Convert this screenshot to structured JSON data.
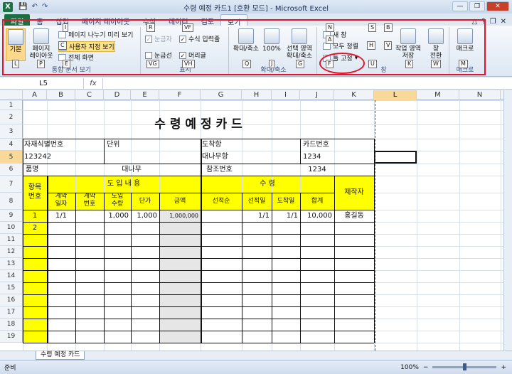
{
  "window": {
    "title": "수령 예정 카드1 [호환 모드] - Microsoft Excel",
    "app_letter": "X",
    "minimize": "—",
    "restore": "❐",
    "close": "✕"
  },
  "qat": {
    "save": "💾",
    "undo": "↶",
    "redo": "↷"
  },
  "tabs": [
    {
      "label": "파일",
      "kt": "F"
    },
    {
      "label": "홈",
      "kt": "H"
    },
    {
      "label": "삽입",
      "kt": "N"
    },
    {
      "label": "페이지 레이아웃",
      "kt": "P"
    },
    {
      "label": "수식",
      "kt": "M"
    },
    {
      "label": "데이터",
      "kt": "A"
    },
    {
      "label": "검토",
      "kt": "R"
    },
    {
      "label": "보기",
      "kt": "W"
    }
  ],
  "tab_right": {
    "minimize_ribbon": "△",
    "help": "?",
    "restore": "❐",
    "close": "✕"
  },
  "ribbon": {
    "workbook_views": {
      "label": "통합 문서 보기",
      "normal": "기본",
      "page_layout": "페이지\n레이아웃",
      "page_break": "페이지 나누기 미리 보기",
      "custom_views": "사용자 지정 보기",
      "full_screen": "전체 화면"
    },
    "show": {
      "label": "표시",
      "ruler": "눈금자",
      "formula_bar": "수식 입력줄",
      "gridlines": "눈금선",
      "headings": "머리글"
    },
    "zoom": {
      "label": "확대/축소",
      "zoom": "확대/축소",
      "hundred": "100%",
      "selection": "선택 영역\n확대/축소"
    },
    "window": {
      "label": "창",
      "new_window": "새 창",
      "arrange_all": "모두 정렬",
      "freeze": "틀 고정",
      "workspace": "작업 영역\n저장",
      "switch": "창\n전환"
    },
    "macros": {
      "label": "매크로",
      "macros": "매크로"
    }
  },
  "keytips": [
    "L",
    "P",
    "I",
    "C",
    "E",
    "R",
    "VF",
    "VG",
    "VH",
    "Q",
    "J",
    "G",
    "N",
    "A",
    "F",
    "S",
    "H",
    "U",
    "B",
    "V",
    "K",
    "W",
    "M"
  ],
  "formula_bar": {
    "name_box": "L5",
    "fx": "fx",
    "value": ""
  },
  "columns": [
    "A",
    "B",
    "C",
    "D",
    "E",
    "F",
    "G",
    "H",
    "I",
    "J",
    "K",
    "L",
    "M",
    "N"
  ],
  "rows": [
    "1",
    "2",
    "3",
    "4",
    "5",
    "6",
    "7",
    "8",
    "9",
    "10",
    "11",
    "12",
    "13",
    "14",
    "15",
    "16",
    "17",
    "18",
    "19"
  ],
  "selected": {
    "column": "L",
    "row": "5"
  },
  "sheet": {
    "title": "수 령 예 정 카 드",
    "asset_no_label": "자재식별번호",
    "asset_no": "123242",
    "unit_label": "단위",
    "dest_label": "도착항",
    "dest": "대나무항",
    "card_no_label": "카드번호",
    "card_no": "1234",
    "item_label": "품명",
    "item": "대나무",
    "ref_label": "참조번호",
    "ref": "1234",
    "item_no_header": "항목\n번호",
    "intro_header": "도 입 내 용",
    "receipt_header": "수          령",
    "maker_header": "제작자",
    "col_heads": [
      "계약\n일자",
      "계약\n번호",
      "도입\n수량",
      "단가",
      "금액",
      "선적순",
      "선적일",
      "도착일",
      "합계"
    ],
    "row1": {
      "no": "1",
      "date": "1/1",
      "qty": "1,000",
      "price": "1,000",
      "amount": "1,000,000",
      "ship_date": "1/1",
      "arrive": "1/1",
      "total": "10,000",
      "maker": "홍길동"
    },
    "row2": {
      "no": "2"
    }
  },
  "sheet_tab": "수령 예정 카드",
  "status": {
    "ready": "준비",
    "zoom": "100%",
    "minus": "−",
    "plus": "+"
  }
}
